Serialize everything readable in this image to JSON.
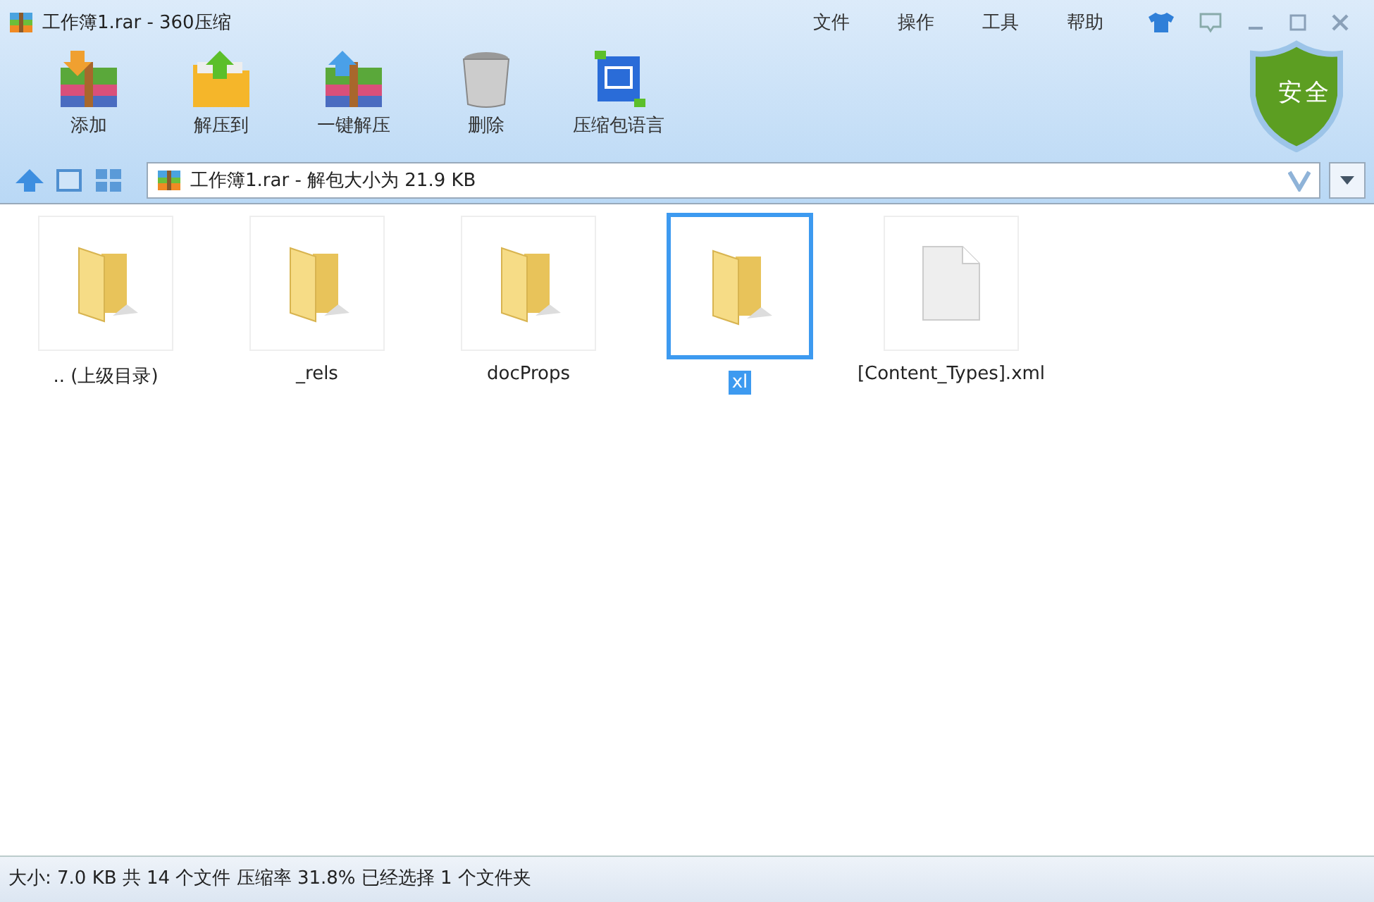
{
  "window": {
    "title": "工作簿1.rar - 360压缩"
  },
  "menu": [
    "文件",
    "操作",
    "工具",
    "帮助"
  ],
  "toolbar": [
    {
      "label": "添加",
      "kind": "add"
    },
    {
      "label": "解压到",
      "kind": "extract"
    },
    {
      "label": "一键解压",
      "kind": "oneclick"
    },
    {
      "label": "删除",
      "kind": "delete"
    },
    {
      "label": "压缩包语言",
      "kind": "language"
    }
  ],
  "shield": {
    "label": "安全"
  },
  "address": {
    "value": "工作簿1.rar - 解包大小为 21.9 KB"
  },
  "files": [
    {
      "name": ".. (上级目录)",
      "kind": "folder",
      "selected": false
    },
    {
      "name": "_rels",
      "kind": "folder",
      "selected": false
    },
    {
      "name": "docProps",
      "kind": "folder",
      "selected": false
    },
    {
      "name": "xl",
      "kind": "folder",
      "selected": true
    },
    {
      "name": "[Content_Types].xml",
      "kind": "file",
      "selected": false
    }
  ],
  "status_bar": "大小: 7.0 KB 共 14 个文件 压缩率 31.8% 已经选择 1 个文件夹"
}
